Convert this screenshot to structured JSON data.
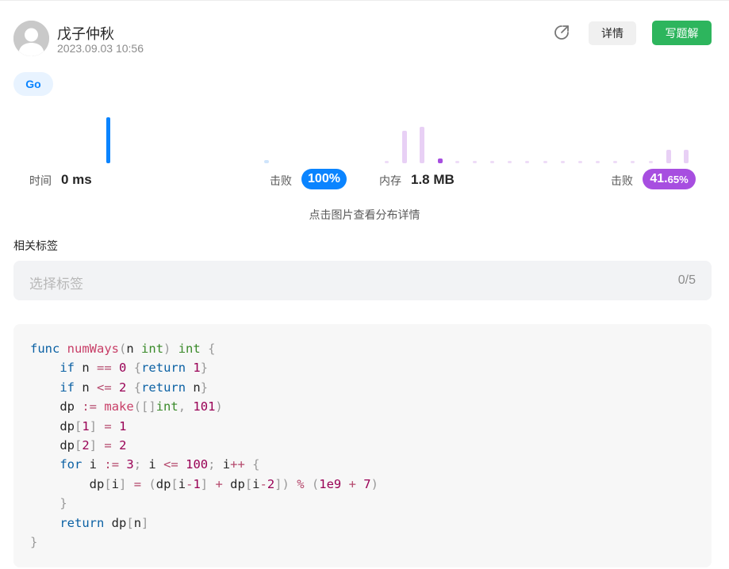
{
  "header": {
    "username": "戊子仲秋",
    "datetime": "2023.09.03 10:56",
    "share_icon": "share-icon",
    "detail_button": "详情",
    "write_solution_button": "写题解"
  },
  "language_tag": "Go",
  "runtime": {
    "label": "时间",
    "value": "0 ms",
    "beat_label": "击败",
    "beat_percent": "100%",
    "accent": "#0a84ff"
  },
  "memory": {
    "label": "内存",
    "value": "1.8 MB",
    "beat_label": "击败",
    "beat_percent_main": "41.",
    "beat_percent_small": "65%",
    "accent": "#a74ee0"
  },
  "distribution_hint": "点击图片查看分布详情",
  "tags": {
    "title": "相关标签",
    "placeholder": "选择标签",
    "count": "0/5"
  },
  "code": {
    "language": "Go",
    "lines": [
      "func numWays(n int) int {",
      "    if n == 0 {return 1}",
      "    if n <= 2 {return n}",
      "    dp := make([]int, 101)",
      "    dp[1] = 1",
      "    dp[2] = 2",
      "    for i := 3; i <= 100; i++ {",
      "        dp[i] = (dp[i-1] + dp[i-2]) % (1e9 + 7)",
      "    }",
      "    return dp[n]",
      "}"
    ]
  }
}
